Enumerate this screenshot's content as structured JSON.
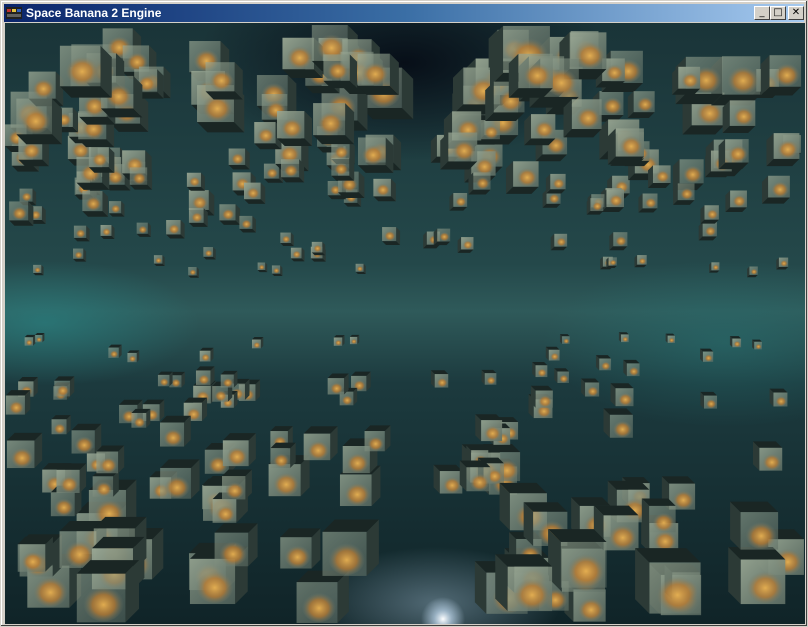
{
  "window": {
    "title": "Space Banana 2 Engine",
    "minimize_symbol": "_",
    "maximize_symbol": "□",
    "close_symbol": "✕",
    "icons": {
      "app": "app-logo-icon",
      "minimize": "minimize-icon",
      "maximize": "maximize-icon",
      "close": "close-icon"
    }
  },
  "scene": {
    "description_colors": {
      "cube_face": "#7a8a78",
      "cube_side": "#3a4a44",
      "cube_dark": "#1a2624",
      "banana_texture": "#d89a3a",
      "nebula": "#2f5a5a"
    }
  }
}
